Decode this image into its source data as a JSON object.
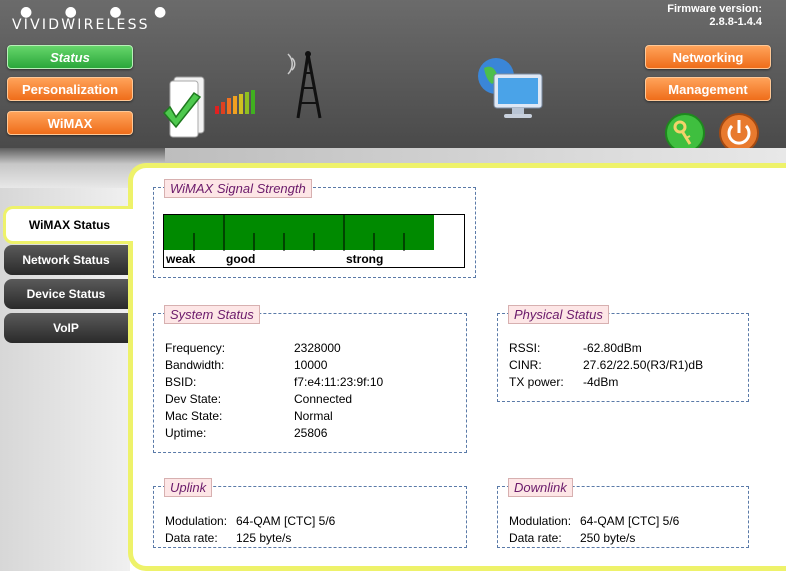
{
  "brand": {
    "dots": "● ● ● ●",
    "name": "VIVIDWIRELESS"
  },
  "firmware": {
    "label": "Firmware version:",
    "version": "2.8.8-1.4.4"
  },
  "nav_left": [
    {
      "label": "Status",
      "active": true
    },
    {
      "label": "Personalization",
      "active": false
    },
    {
      "label": "WiMAX",
      "active": false
    }
  ],
  "nav_right": [
    {
      "label": "Networking"
    },
    {
      "label": "Management"
    }
  ],
  "icons": {
    "wizard": "green-check-icon",
    "signal_bars": "signal-bars-icon",
    "tower": "antenna-tower-icon",
    "computer": "globe-computer-icon",
    "keys": "keys-icon",
    "power": "power-icon"
  },
  "sidebar": [
    {
      "label": "WiMAX Status",
      "active": true
    },
    {
      "label": "Network Status",
      "active": false
    },
    {
      "label": "Device Status",
      "active": false
    },
    {
      "label": "VoIP",
      "active": false
    }
  ],
  "signal": {
    "title": "WiMAX Signal Strength",
    "level": 0.9,
    "labels": {
      "weak": "weak",
      "good": "good",
      "strong": "strong"
    },
    "color": "#008a00"
  },
  "system_status": {
    "title": "System Status",
    "rows": [
      {
        "label": "Frequency:",
        "value": "2328000"
      },
      {
        "label": "Bandwidth:",
        "value": "10000"
      },
      {
        "label": "BSID:",
        "value": "f7:e4:11:23:9f:10"
      },
      {
        "label": "Dev State:",
        "value": "Connected"
      },
      {
        "label": "Mac State:",
        "value": "Normal"
      },
      {
        "label": "Uptime:",
        "value": "25806"
      }
    ]
  },
  "physical_status": {
    "title": "Physical Status",
    "rows": [
      {
        "label": "RSSI:",
        "value": "-62.80dBm"
      },
      {
        "label": "CINR:",
        "value": "27.62/22.50(R3/R1)dB"
      },
      {
        "label": "TX power:",
        "value": "-4dBm"
      }
    ]
  },
  "uplink": {
    "title": "Uplink",
    "rows": [
      {
        "label": "Modulation:",
        "value": "64-QAM [CTC] 5/6"
      },
      {
        "label": "Data rate:",
        "value": "125 byte/s"
      }
    ]
  },
  "downlink": {
    "title": "Downlink",
    "rows": [
      {
        "label": "Modulation:",
        "value": "64-QAM [CTC] 5/6"
      },
      {
        "label": "Data rate:",
        "value": "250 byte/s"
      }
    ]
  },
  "colors": {
    "accent_yellow": "#eef26a",
    "nav_orange": "#ef6d1a",
    "nav_green": "#2aa63a",
    "legend_text": "#6b1a6b"
  }
}
